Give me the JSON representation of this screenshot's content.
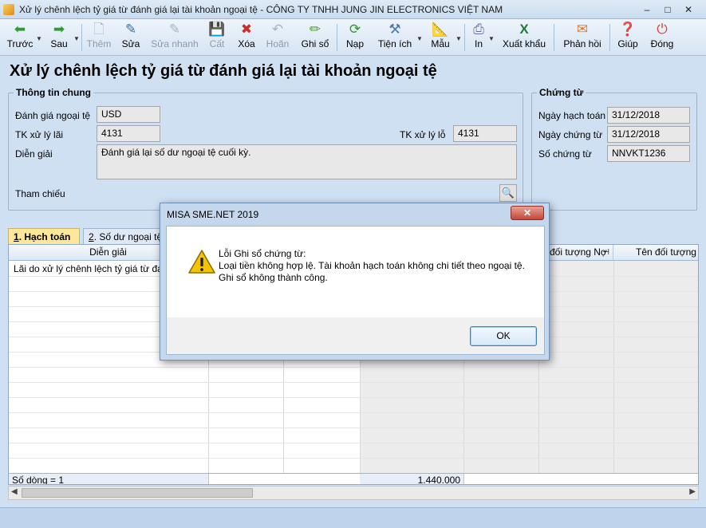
{
  "window": {
    "title": "Xử lý chênh lệch tỷ giá từ đánh giá lại tài khoản ngoại tệ - CÔNG TY TNHH JUNG JIN ELECTRONICS VIỆT NAM",
    "minimize": "–",
    "maximize": "□",
    "close": "✕"
  },
  "toolbar": {
    "back": "Trước",
    "next": "Sau",
    "add": "Thêm",
    "edit": "Sửa",
    "quick_edit": "Sửa nhanh",
    "save": "Cất",
    "delete": "Xóa",
    "undo": "Hoãn",
    "post": "Ghi sổ",
    "load": "Nạp",
    "utilities": "Tiện ích",
    "template": "Mẫu",
    "print": "In",
    "export": "Xuất khẩu",
    "feedback": "Phản hồi",
    "help": "Giúp",
    "close": "Đóng"
  },
  "page_title": "Xử lý chênh lệch tỷ giá từ đánh giá lại tài khoản ngoại tệ",
  "general": {
    "group_title": "Thông tin chung",
    "currency_label": "Đánh giá ngoại tệ",
    "currency_value": "USD",
    "gain_account_label": "TK xử lý lãi",
    "gain_account_value": "4131",
    "loss_account_label": "TK xử lý lỗ",
    "loss_account_value": "4131",
    "description_label": "Diễn giải",
    "description_value": "Đánh giá lại số dư ngoại tệ cuối kỳ.",
    "reference_label": "Tham chiếu"
  },
  "voucher": {
    "group_title": "Chứng từ",
    "posting_date_label": "Ngày hạch toán",
    "posting_date_value": "31/12/2018",
    "voucher_date_label": "Ngày chứng từ",
    "voucher_date_value": "31/12/2018",
    "voucher_no_label": "Số chứng từ",
    "voucher_no_value": "NNVKT1236"
  },
  "tabs": [
    {
      "key": "1",
      "label": ". Hạch toán"
    },
    {
      "key": "2",
      "label": ". Số dư ngoại tệ"
    }
  ],
  "grid": {
    "headers": {
      "description": "Diễn giải",
      "debit_object": "đối tượng Nợ",
      "object_name": "Tên đối tượng N"
    },
    "rows": [
      {
        "description": "Lãi do xử lý chênh lệch tỷ giá từ đánh"
      }
    ],
    "footer_count": "Số dòng = 1",
    "footer_total": "1.440.000"
  },
  "dialog": {
    "title": "MISA SME.NET 2019",
    "close": "✕",
    "line1": "Lỗi Ghi sổ chứng từ:",
    "line2": "Loại tiền không hợp lệ. Tài khoản hạch toán không chi tiết theo ngoại tệ.",
    "line3": "Ghi sổ không thành công.",
    "ok": "OK"
  }
}
